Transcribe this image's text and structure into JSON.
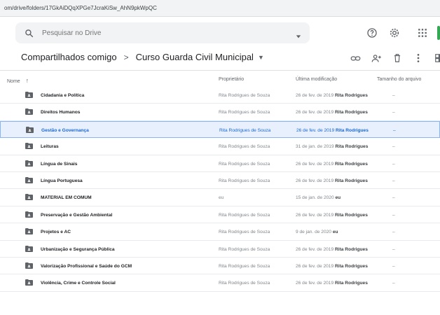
{
  "browser": {
    "url": "om/drive/folders/17GkAiDQqXPGe7JcraKiSw_AhN9pkWpQC"
  },
  "search": {
    "placeholder": "Pesquisar no Drive"
  },
  "breadcrumb": {
    "parent": "Compartilhados comigo",
    "separator": ">",
    "current": "Curso Guarda Civil Municipal"
  },
  "columns": {
    "name": "Nome",
    "owner": "Proprietário",
    "modified": "Última modificação",
    "size": "Tamanho do arquivo"
  },
  "sort_arrow": "↑",
  "rows": [
    {
      "name": "Cidadania e Política",
      "owner": "Rita Rodrigues de Souza",
      "date": "26 de fev. de 2019",
      "by": "Rita Rodrigues",
      "size": "–"
    },
    {
      "name": "Direitos Humanos",
      "owner": "Rita Rodrigues de Souza",
      "date": "26 de fev. de 2019",
      "by": "Rita Rodrigues",
      "size": "–"
    },
    {
      "name": "Gestão e Governança",
      "owner": "Rita Rodrigues de Souza",
      "date": "26 de fev. de 2019",
      "by": "Rita Rodrigues",
      "size": "–"
    },
    {
      "name": "Leituras",
      "owner": "Rita Rodrigues de Souza",
      "date": "31 de jan. de 2019",
      "by": "Rita Rodrigues",
      "size": "–"
    },
    {
      "name": "Língua de Sinais",
      "owner": "Rita Rodrigues de Souza",
      "date": "26 de fev. de 2019",
      "by": "Rita Rodrigues",
      "size": "–"
    },
    {
      "name": "Língua Portuguesa",
      "owner": "Rita Rodrigues de Souza",
      "date": "26 de fev. de 2019",
      "by": "Rita Rodrigues",
      "size": "–"
    },
    {
      "name": "MATERIAL EM COMUM",
      "owner": "eu",
      "date": "15 de jan. de 2020",
      "by": "eu",
      "size": "–"
    },
    {
      "name": "Preservação e Gestão Ambiental",
      "owner": "Rita Rodrigues de Souza",
      "date": "26 de fev. de 2019",
      "by": "Rita Rodrigues",
      "size": "–"
    },
    {
      "name": "Projetos e AC",
      "owner": "Rita Rodrigues de Souza",
      "date": "9 de jan. de 2020",
      "by": "eu",
      "size": "–"
    },
    {
      "name": "Urbanização e Segurança Pública",
      "owner": "Rita Rodrigues de Souza",
      "date": "26 de fev. de 2019",
      "by": "Rita Rodrigues",
      "size": "–"
    },
    {
      "name": "Valorização Profissional e Saúde do GCM",
      "owner": "Rita Rodrigues de Souza",
      "date": "26 de fev. de 2019",
      "by": "Rita Rodrigues",
      "size": "–"
    },
    {
      "name": "Violência, Crime e Controle Social",
      "owner": "Rita Rodrigues de Souza",
      "date": "26 de fev. de 2019",
      "by": "Rita Rodrigues",
      "size": "–"
    }
  ],
  "selected_row": 2,
  "colors": {
    "selected_bg": "#e8f0fe",
    "selected_text": "#1967d2",
    "folder_icon": "#5f6368"
  }
}
